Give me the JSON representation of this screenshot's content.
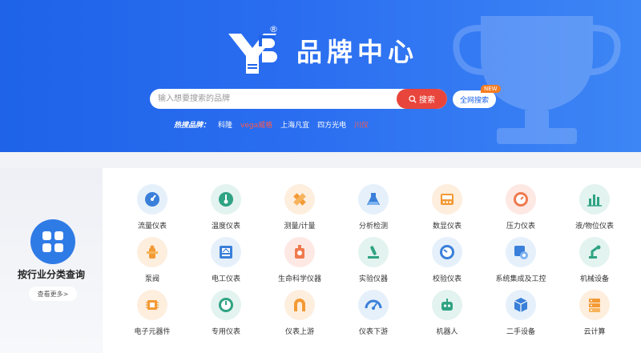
{
  "header": {
    "title": "品牌中心",
    "registered_mark": "®"
  },
  "search": {
    "placeholder": "输入想要搜索的品牌",
    "button_label": "搜索",
    "all_search_label": "全网搜索",
    "new_badge": "NEW"
  },
  "hot_brands": {
    "label": "热搜品牌：",
    "items": [
      "科隆",
      "vega威格",
      "上海凡宜",
      "四方光电",
      "川仪"
    ]
  },
  "sidebar": {
    "title": "按行业分类查询",
    "more_label": "查看更多>"
  },
  "categories": [
    {
      "label": "流量仪表",
      "icon": "gauge-icon"
    },
    {
      "label": "温度仪表",
      "icon": "thermometer-icon"
    },
    {
      "label": "测量/计量",
      "icon": "ruler-icon"
    },
    {
      "label": "分析检测",
      "icon": "flask-icon"
    },
    {
      "label": "数显仪表",
      "icon": "display-meter-icon"
    },
    {
      "label": "压力仪表",
      "icon": "pressure-gauge-icon"
    },
    {
      "label": "液/物位仪表",
      "icon": "level-meter-icon"
    },
    {
      "label": "泵阀",
      "icon": "hydrant-icon"
    },
    {
      "label": "电工仪表",
      "icon": "electric-meter-icon"
    },
    {
      "label": "生命科学仪器",
      "icon": "life-science-icon"
    },
    {
      "label": "实验仪器",
      "icon": "test-tube-icon"
    },
    {
      "label": "校验仪表",
      "icon": "calibration-gauge-icon"
    },
    {
      "label": "系统集成及工控",
      "icon": "system-integration-icon"
    },
    {
      "label": "机械设备",
      "icon": "robot-arm-icon"
    },
    {
      "label": "电子元器件",
      "icon": "chip-icon"
    },
    {
      "label": "专用仪表",
      "icon": "dial-icon"
    },
    {
      "label": "仪表上游",
      "icon": "magnet-icon"
    },
    {
      "label": "仪表下游",
      "icon": "speedometer-icon"
    },
    {
      "label": "机器人",
      "icon": "robot-icon"
    },
    {
      "label": "二手设备",
      "icon": "box-icon"
    },
    {
      "label": "云计算",
      "icon": "server-icon"
    }
  ],
  "colors": {
    "banner": "#1e63e8",
    "accent_red": "#e8453c",
    "accent_blue": "#2f7be6"
  }
}
